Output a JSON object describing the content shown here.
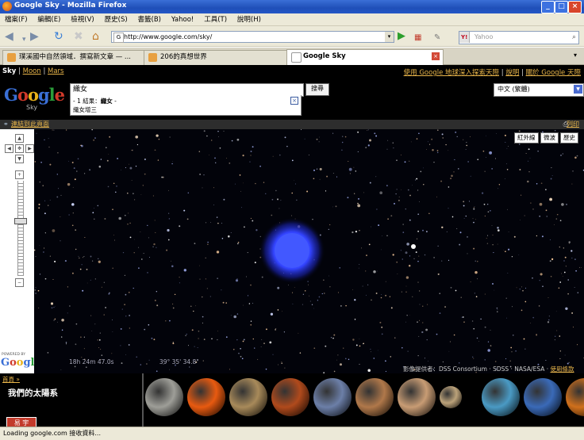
{
  "window": {
    "title": "Google Sky - Mozilla Firefox",
    "buttons": [
      "_",
      "□",
      "×"
    ]
  },
  "menu": [
    "檔案(F)",
    "編輯(E)",
    "檢視(V)",
    "歷史(S)",
    "書籤(B)",
    "Yahoo!",
    "工具(T)",
    "說明(H)"
  ],
  "nav": {
    "url": "http://www.google.com/sky/",
    "search_placeholder": "Yahoo",
    "search_engine": "Y!"
  },
  "tabs": [
    {
      "label": "璞溪國中自然領域．撰寫新文章 — ...",
      "active": false
    },
    {
      "label": "206的真想世界",
      "active": false
    },
    {
      "label": "Google Sky",
      "active": true
    }
  ],
  "page": {
    "top_links": {
      "sky": "Sky",
      "moon": "Moon",
      "mars": "Mars",
      "separator": "|"
    },
    "right_links": {
      "earth": "使用 Google 地球深入探索天際",
      "help": "說明",
      "about": "關於 Google 天際",
      "separator": "|"
    },
    "logo": {
      "text": "Google",
      "sub": "Sky"
    },
    "query": "織女",
    "suggest": {
      "line1_prefix": "- 1 結果：",
      "line1_bold": "織女",
      "line1_suffix": " -",
      "line2": "織女增三"
    },
    "search_button": "搜尋",
    "language": "中文 (繁體)",
    "link_here": "連結到此頁面",
    "print": "列印",
    "layers": [
      "紅外線",
      "微波",
      "歷史"
    ],
    "coords": {
      "ra": "18h 24m 47.0s",
      "dec": "39° 35' 34.8\""
    },
    "credits": {
      "prefix": "影像提供者：DSS Consortium · SDSS · NASA/ESA · ",
      "link": "使用條款"
    },
    "powered": "POWERED BY",
    "powered_logo": "Google",
    "breadcrumb": "首頁 »",
    "solar_title": "我們的太陽系",
    "badge": "易 宇"
  },
  "status": "Loading google.com 接收資料...",
  "colors": {
    "menubg": "#ece9d8",
    "accent_link": "#e8b54a",
    "titlebar": "#2356c6",
    "star_blue": "#3f55ff"
  },
  "planets": [
    {
      "name": "moon",
      "color": "#9e9e98"
    },
    {
      "name": "sun",
      "color": "#e85a10"
    },
    {
      "name": "mercury",
      "color": "#a88a5a"
    },
    {
      "name": "venus",
      "color": "#b04a1c"
    },
    {
      "name": "earth",
      "color": "#6c7fa8"
    },
    {
      "name": "mars",
      "color": "#b0784a"
    },
    {
      "name": "jupiter",
      "color": "#c89c74"
    },
    {
      "name": "saturn",
      "color": "#bba27a"
    },
    {
      "name": "uranus",
      "color": "#4a9ac4"
    },
    {
      "name": "neptune",
      "color": "#3a6ab8"
    },
    {
      "name": "pluto",
      "color": "#d0701c"
    }
  ]
}
